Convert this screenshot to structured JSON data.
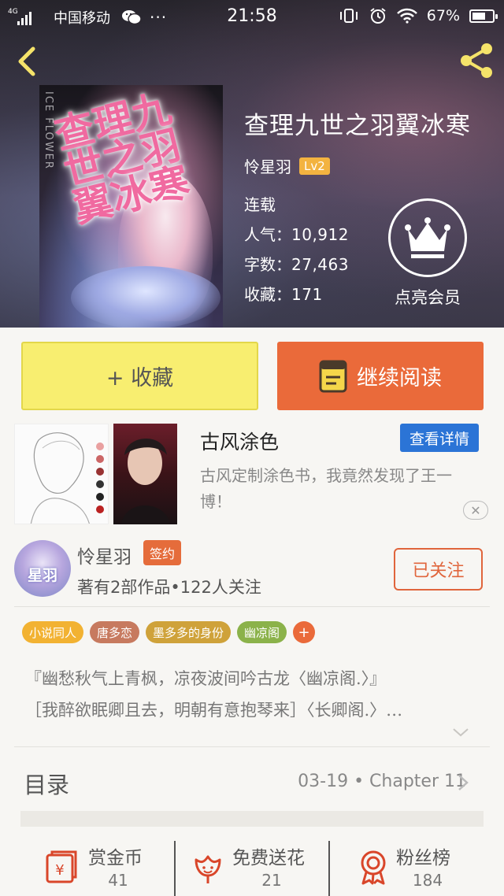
{
  "status_bar": {
    "network": "4G",
    "carrier": "中国移动",
    "more": "···",
    "time": "21:58",
    "battery": "67%",
    "battery_level": 0.67
  },
  "book": {
    "title": "查理九世之羽翼冰寒",
    "author": "怜星羽",
    "level": "Lv2",
    "status": "连载",
    "popularity_label": "人气：",
    "popularity": "10,912",
    "words_label": "字数：",
    "words": "27,463",
    "favorites_label": "收藏：",
    "favorites": "171",
    "cover_title": "查理九世之羽翼冰寒",
    "cover_side_text": "ICE FLOWER"
  },
  "vip": {
    "label": "点亮会员"
  },
  "actions": {
    "favorite_label": "+ 收藏",
    "continue_label": "继续阅读"
  },
  "ad": {
    "title": "古风涂色",
    "button": "查看详情",
    "description": "古风定制涂色书，我竟然发现了王一博！",
    "close": "✕"
  },
  "author_card": {
    "avatar_text": "星羽",
    "name": "怜星羽",
    "badge": "签约",
    "stats": "著有2部作品•122人关注",
    "follow_label": "已关注"
  },
  "tags": [
    {
      "label": "小说同人",
      "color": "#f2b232"
    },
    {
      "label": "唐多恋",
      "color": "#c77a5f"
    },
    {
      "label": "墨多多的身份",
      "color": "#cfa23a"
    },
    {
      "label": "幽凉阁",
      "color": "#8bb24a"
    }
  ],
  "tag_more": "+",
  "intro": {
    "line1": "『幽愁秋气上青枫，凉夜波间吟古龙〈幽凉阁.〉』",
    "line2": "［我醉欲眠卿且去，明朝有意抱琴来］〈长卿阁.〉…"
  },
  "catalog": {
    "title": "目录",
    "latest": "03-19 • Chapter 11"
  },
  "bottom_bar": [
    {
      "label": "赏金币",
      "value": "41",
      "icon": "reward-icon"
    },
    {
      "label": "免费送花",
      "value": "21",
      "icon": "flower-icon"
    },
    {
      "label": "粉丝榜",
      "value": "184",
      "icon": "medal-icon"
    }
  ],
  "colors": {
    "accent": "#ea6a3a",
    "favorite_button": "#f8ee70",
    "ad_button": "#2b74d6",
    "level_badge": "#f3b340"
  }
}
